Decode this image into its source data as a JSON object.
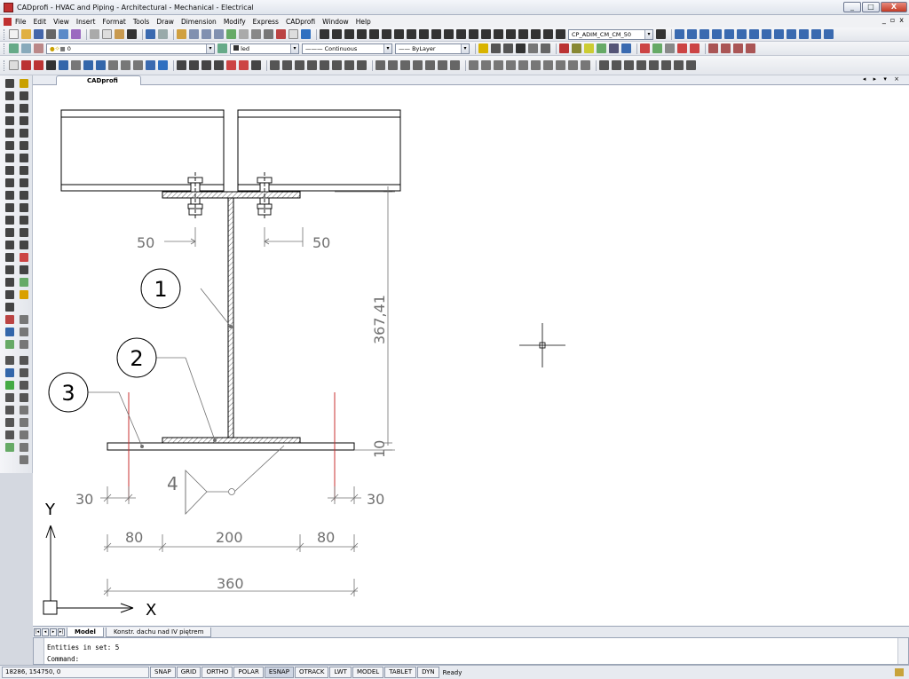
{
  "window": {
    "title": "CADprofi - HVAC and Piping - Architectural - Mechanical - Electrical",
    "controls": [
      "_",
      "□",
      "X"
    ]
  },
  "menu": {
    "items": [
      "File",
      "Edit",
      "View",
      "Insert",
      "Format",
      "Tools",
      "Draw",
      "Dimension",
      "Modify",
      "Express",
      "CADprofi",
      "Window",
      "Help"
    ],
    "doc_controls": [
      "_",
      "▫",
      "x"
    ]
  },
  "toolbars": {
    "dimstyle_value": "CP_ADIM_CM_CM_50",
    "layer_value": "0",
    "color_value": "led",
    "linetype_value": "Continuous",
    "lineweight_value": "ByLayer"
  },
  "doc_tab": {
    "label": "CADprofi",
    "nav": "◂ ▸ ▾ ×"
  },
  "drawing": {
    "callouts": [
      "1",
      "2",
      "3"
    ],
    "weld_symbol_number": "4",
    "dims": {
      "bolt_left": "50",
      "bolt_right": "50",
      "vertical_height": "367,41",
      "vertical_plate": "10",
      "edge_left": "30",
      "edge_right": "30",
      "seg_left": "80",
      "seg_mid": "200",
      "seg_right": "80",
      "total": "360"
    },
    "ucs": {
      "x": "X",
      "y": "Y"
    }
  },
  "layouts": {
    "tabs": [
      "Model",
      "Konstr. dachu nad IV piętrem"
    ]
  },
  "command": {
    "history": "Entities in set: 5",
    "prompt": "Command:"
  },
  "status": {
    "coords": "18286,  154750,  0",
    "toggles": [
      "SNAP",
      "GRID",
      "ORTHO",
      "POLAR",
      "ESNAP",
      "OTRACK",
      "LWT",
      "MODEL",
      "TABLET",
      "DYN"
    ],
    "message": "Ready"
  },
  "colors": {
    "red_line": "#c83030",
    "dim_gray": "#707070"
  }
}
